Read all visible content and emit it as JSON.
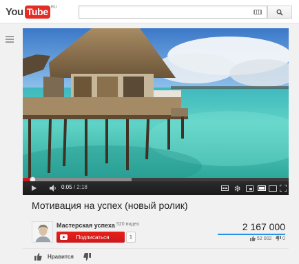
{
  "header": {
    "logo_you": "You",
    "logo_tube": "Tube",
    "logo_region": "RU",
    "search_value": ""
  },
  "player": {
    "current_time": "0:05",
    "duration": "2:18",
    "played_fraction": 0.036,
    "loaded_fraction": 0.41
  },
  "video": {
    "title": "Мотивация на успех (новый ролик)",
    "views": "2 167 000",
    "likes": "52 002",
    "dislikes": "0",
    "like_label": "Нравится"
  },
  "channel": {
    "name": "Мастерская успеха",
    "video_count": "520 видео",
    "subscribe_label": "Подписаться",
    "subscriber_count": "1"
  },
  "colors": {
    "brand_red": "#cc181e",
    "like_bar": "#2793e6"
  },
  "icons": [
    "guide-menu-icon",
    "keyboard-icon",
    "search-icon",
    "play-icon",
    "volume-icon",
    "settings-icon",
    "miniplayer-icon",
    "theater-mode-icon",
    "size-icon",
    "fullscreen-icon",
    "thumbs-up-icon",
    "thumbs-down-icon"
  ]
}
